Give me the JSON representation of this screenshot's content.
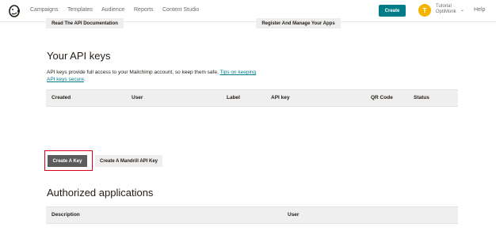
{
  "nav": {
    "items": [
      "Campaigns",
      "Templates",
      "Audience",
      "Reports",
      "Content Studio"
    ],
    "create_label": "Create",
    "avatar_initial": "T",
    "account_line1": "Tutorial",
    "account_line2": "OptiMonk",
    "help_label": "Help",
    "logo_icon": "mailchimp-logo-icon",
    "accent_color": "#007c89"
  },
  "top_buttons": {
    "docs_label": "Read The API Documentation",
    "register_label": "Register And Manage Your Apps"
  },
  "api_keys": {
    "title": "Your API keys",
    "description": "API keys provide full access to your Mailchimp account, so keep them safe. ",
    "tips_link": "Tips on keeping API keys secure",
    "description_end": ".",
    "columns": [
      "Created",
      "User",
      "Label",
      "API key",
      "QR Code",
      "Status"
    ],
    "create_key_label": "Create A Key",
    "mandrill_label": "Create A Mandrill API Key"
  },
  "authorized_apps": {
    "title": "Authorized applications",
    "columns": [
      "Description",
      "User"
    ]
  }
}
